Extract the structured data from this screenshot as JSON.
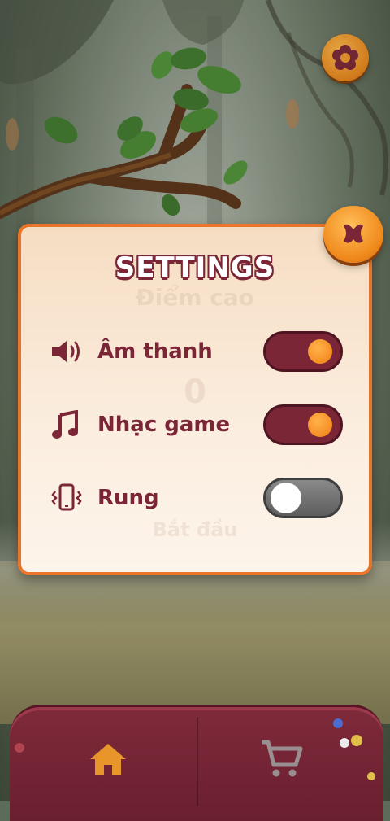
{
  "settings": {
    "title": "SETTINGS",
    "background_ghost": {
      "high_score_label": "Điểm cao",
      "high_score_value": "0",
      "start_label": "Bắt đầu"
    },
    "options": [
      {
        "label": "Âm thanh",
        "icon": "speaker-icon",
        "enabled": true
      },
      {
        "label": "Nhạc game",
        "icon": "music-note-icon",
        "enabled": true
      },
      {
        "label": "Rung",
        "icon": "vibrate-phone-icon",
        "enabled": false
      }
    ]
  },
  "nav": {
    "items": [
      {
        "icon": "home-icon",
        "active": true
      },
      {
        "icon": "cart-icon",
        "active": false
      }
    ]
  },
  "colors": {
    "accent": "#e8762a",
    "maroon": "#7a2636",
    "knob_on": "#f07f14"
  }
}
